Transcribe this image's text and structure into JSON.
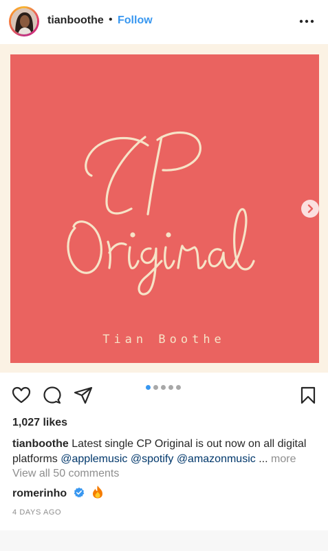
{
  "header": {
    "username": "tianboothe",
    "separator": "•",
    "follow_label": "Follow",
    "more_icon": "more-horizontal-icon"
  },
  "post": {
    "artwork": {
      "title_line1": "CP",
      "title_line2": "Original",
      "artist": "Tian Boothe",
      "background": "#ea6360",
      "text_color": "#f6e3c7"
    },
    "carousel": {
      "count": 5,
      "active": 0
    }
  },
  "actions": {
    "like_icon": "heart-icon",
    "comment_icon": "comment-icon",
    "share_icon": "send-icon",
    "save_icon": "bookmark-icon"
  },
  "likes": "1,027 likes",
  "caption": {
    "username": "tianboothe",
    "text": "Latest single CP Original is out now on all digital platforms",
    "mentions": [
      "@applemusic",
      "@spotify",
      "@amazonmusic"
    ],
    "ellipsis": "...",
    "more_label": "more"
  },
  "view_comments": "View all 50 comments",
  "comment": {
    "username": "romerinho",
    "verified_icon": "verified-badge-icon",
    "text_icon": "fire-emoji-icon"
  },
  "timestamp": "4 DAYS AGO",
  "colors": {
    "link": "#3897f0",
    "mention": "#00376b",
    "muted": "#8e8e8e"
  }
}
